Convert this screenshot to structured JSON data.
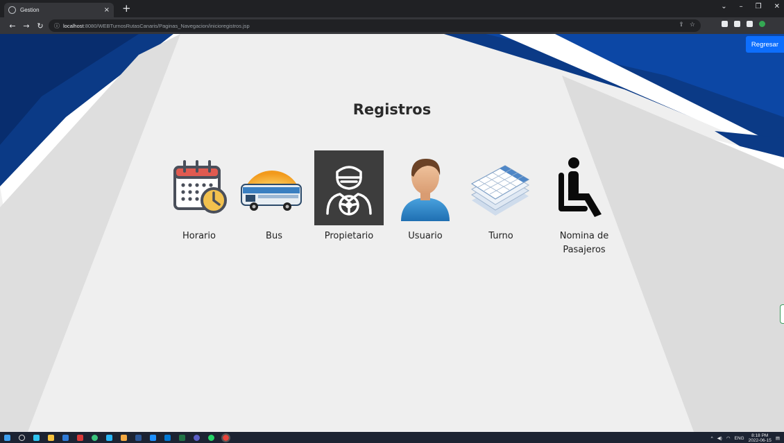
{
  "browser": {
    "tab_title": "Gestion",
    "tab_close": "×",
    "new_tab": "+",
    "url_host": "localhost",
    "url_path": ":8080/WEBTurnosRutasCanaris/Paginas_Navegacion/inicioregistros.jsp"
  },
  "page": {
    "back_button": "Regresar",
    "heading": "Registros",
    "items": [
      {
        "label": "Horario",
        "icon": "calendar-clock-icon"
      },
      {
        "label": "Bus",
        "icon": "bus-icon"
      },
      {
        "label": "Propietario",
        "icon": "driver-icon"
      },
      {
        "label": "Usuario",
        "icon": "user-icon"
      },
      {
        "label": "Turno",
        "icon": "spreadsheet-icon"
      },
      {
        "label": "Nomina de Pasajeros",
        "icon": "seated-passenger-icon"
      }
    ]
  },
  "taskbar": {
    "language": "ENG",
    "time": "8:18 PM",
    "date": "2022-06-15"
  },
  "colors": {
    "accent_blue": "#0d6efd",
    "background_blue": "#0a3d8f",
    "selected_tile": "#3d3d3d"
  }
}
